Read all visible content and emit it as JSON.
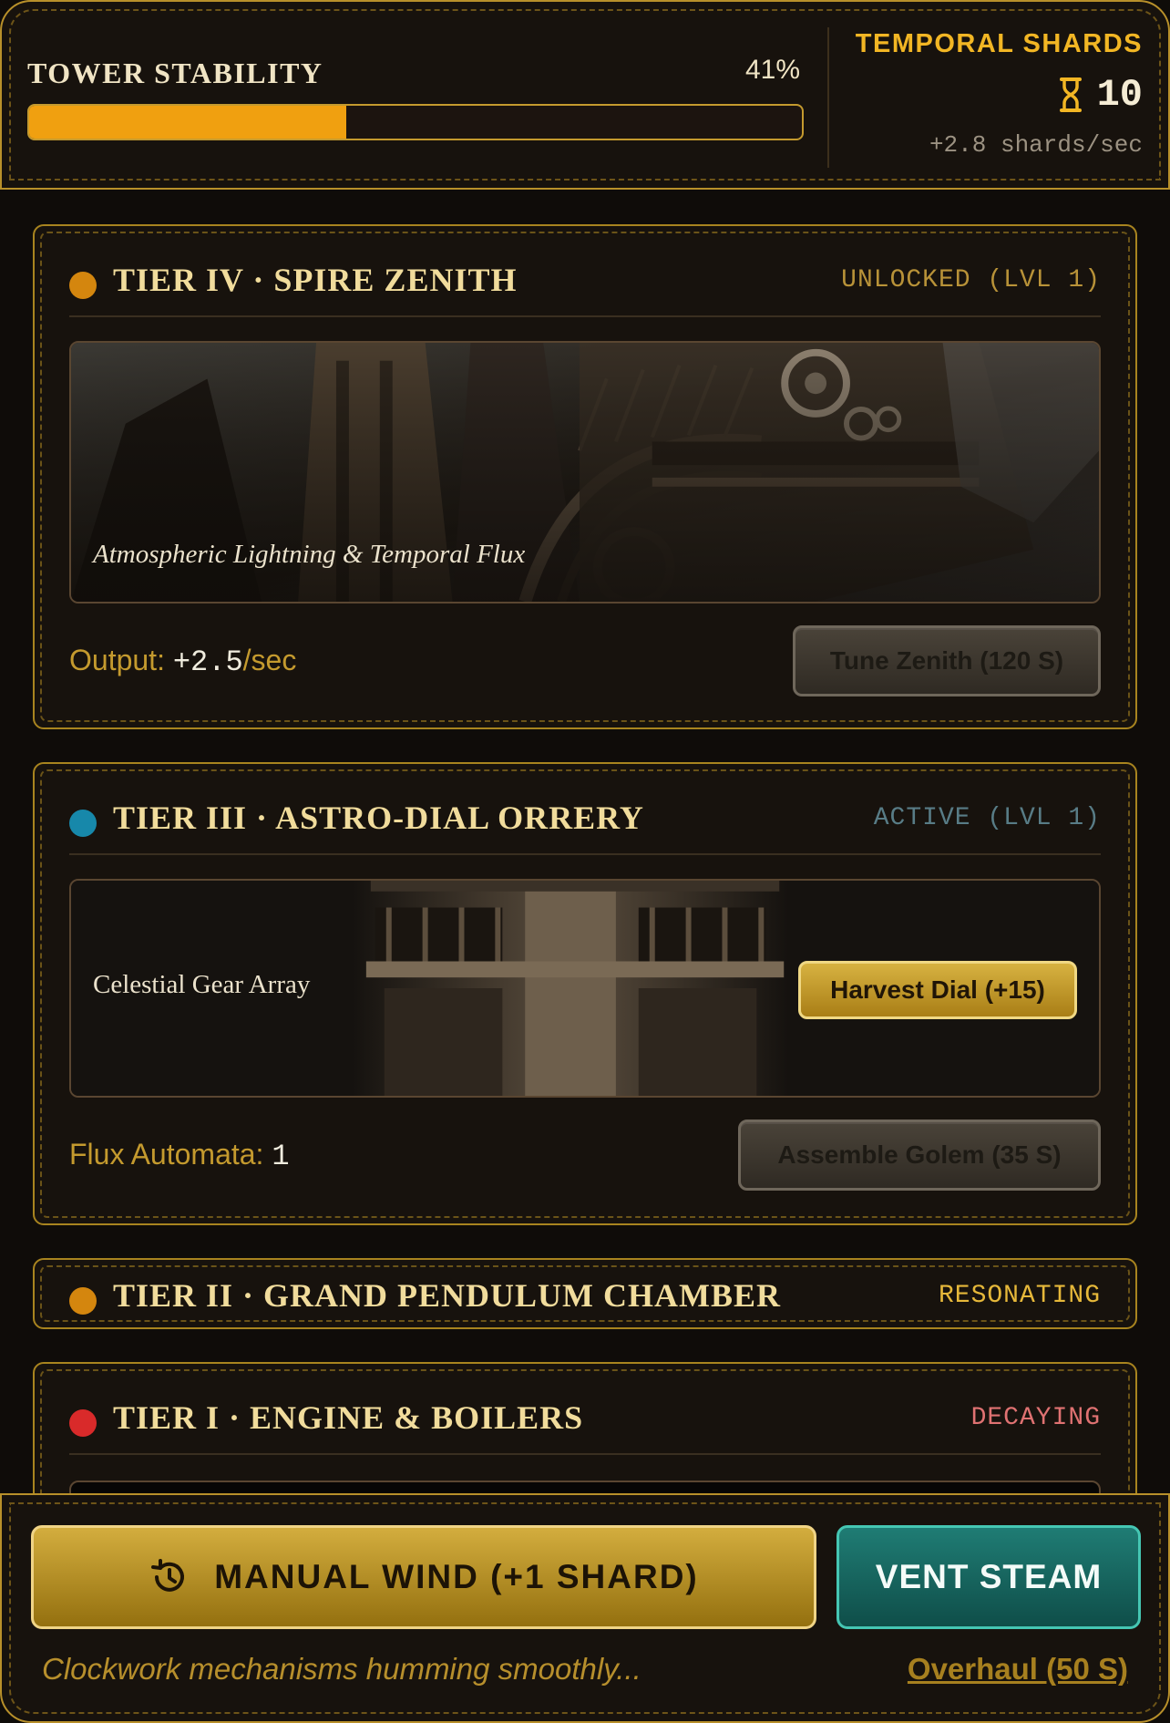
{
  "header": {
    "stability_title": "TOWER STABILITY",
    "stability_percent_label": "41%",
    "stability_value": 41,
    "shards_title": "TEMPORAL SHARDS",
    "shards_count": "10",
    "shards_rate": "+2.8 shards/sec",
    "shards_icon": "hourglass-icon"
  },
  "tiers": [
    {
      "title": "TIER IV · SPIRE ZENITH",
      "status": "UNLOCKED (LVL 1)",
      "dot_color": "#d4860e",
      "status_color": "#b89238",
      "scene_caption": "Atmospheric Lightning & Temporal Flux",
      "stat_label": "Output:",
      "stat_value": "+2.5",
      "stat_suffix": "/sec",
      "action": "Tune Zenith (120 S)"
    },
    {
      "title": "TIER III · ASTRO-DIAL ORRERY",
      "status": "ACTIVE (LVL 1)",
      "dot_color": "#1788aa",
      "status_color": "#587c86",
      "scene_caption": "Celestial Gear Array",
      "scene_action": "Harvest Dial (+15)",
      "stat_label": "Flux Automata:",
      "stat_value": "1",
      "action": "Assemble Golem (35 S)"
    },
    {
      "title": "TIER II · GRAND PENDULUM CHAMBER",
      "status": "RESONATING",
      "dot_color": "#d4860e",
      "status_color": "#e6b83a"
    },
    {
      "title": "TIER I · ENGINE & BOILERS",
      "status": "DECAYING",
      "dot_color": "#d92a2a",
      "status_color": "#e07272"
    }
  ],
  "footer": {
    "wind_label": "MANUAL WIND (+1 SHARD)",
    "wind_icon": "history-icon",
    "vent_label": "VENT STEAM",
    "status_message": "Clockwork mechanisms humming smoothly...",
    "overhaul_label": "Overhaul (50 S)"
  },
  "colors": {
    "accent_gold": "#f0a010",
    "teal": "#1f7c74",
    "border_gold": "#b8902a"
  }
}
